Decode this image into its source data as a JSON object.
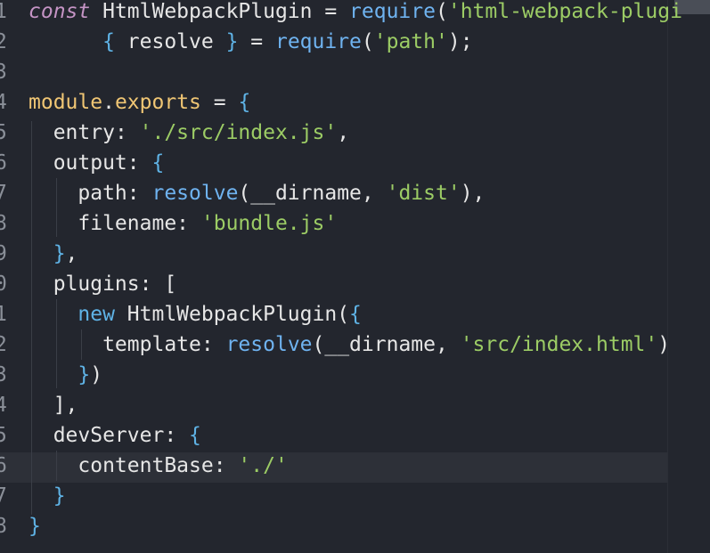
{
  "editor": {
    "language": "javascript",
    "lines": [
      {
        "number": "1",
        "tokens": [
          {
            "t": "const ",
            "c": "kw"
          },
          {
            "t": "HtmlWebpackPlugin ",
            "c": "ident"
          },
          {
            "t": "= ",
            "c": "punc"
          },
          {
            "t": "require",
            "c": "fn"
          },
          {
            "t": "(",
            "c": "punc"
          },
          {
            "t": "'html-webpack-plugi",
            "c": "str"
          }
        ]
      },
      {
        "number": "2",
        "tokens": [
          {
            "t": "      { ",
            "c": "brace"
          },
          {
            "t": "resolve ",
            "c": "ident"
          },
          {
            "t": "} ",
            "c": "brace"
          },
          {
            "t": "= ",
            "c": "punc"
          },
          {
            "t": "require",
            "c": "fn"
          },
          {
            "t": "(",
            "c": "punc"
          },
          {
            "t": "'path'",
            "c": "str"
          },
          {
            "t": ");",
            "c": "punc"
          }
        ]
      },
      {
        "number": "3",
        "tokens": []
      },
      {
        "number": "4",
        "tokens": [
          {
            "t": "module",
            "c": "obj"
          },
          {
            "t": ".",
            "c": "dot"
          },
          {
            "t": "exports ",
            "c": "exports"
          },
          {
            "t": "= ",
            "c": "punc"
          },
          {
            "t": "{",
            "c": "brace"
          }
        ]
      },
      {
        "number": "5",
        "tokens": [
          {
            "t": "  entry",
            "c": "prop"
          },
          {
            "t": ": ",
            "c": "punc"
          },
          {
            "t": "'./src/index.js'",
            "c": "str"
          },
          {
            "t": ",",
            "c": "punc"
          }
        ]
      },
      {
        "number": "6",
        "tokens": [
          {
            "t": "  output",
            "c": "prop"
          },
          {
            "t": ": ",
            "c": "punc"
          },
          {
            "t": "{",
            "c": "brace"
          }
        ]
      },
      {
        "number": "7",
        "tokens": [
          {
            "t": "    path",
            "c": "prop"
          },
          {
            "t": ": ",
            "c": "punc"
          },
          {
            "t": "resolve",
            "c": "fn"
          },
          {
            "t": "(__dirname, ",
            "c": "punc"
          },
          {
            "t": "'dist'",
            "c": "str"
          },
          {
            "t": "),",
            "c": "punc"
          }
        ]
      },
      {
        "number": "8",
        "tokens": [
          {
            "t": "    filename",
            "c": "prop"
          },
          {
            "t": ": ",
            "c": "punc"
          },
          {
            "t": "'bundle.js'",
            "c": "str"
          }
        ]
      },
      {
        "number": "9",
        "tokens": [
          {
            "t": "  }",
            "c": "brace"
          },
          {
            "t": ",",
            "c": "punc"
          }
        ]
      },
      {
        "number": "0",
        "tokens": [
          {
            "t": "  plugins",
            "c": "prop"
          },
          {
            "t": ": [",
            "c": "punc"
          }
        ]
      },
      {
        "number": "1",
        "tokens": [
          {
            "t": "    new ",
            "c": "kw2"
          },
          {
            "t": "HtmlWebpackPlugin",
            "c": "ident"
          },
          {
            "t": "(",
            "c": "punc"
          },
          {
            "t": "{",
            "c": "brace"
          }
        ]
      },
      {
        "number": "2",
        "tokens": [
          {
            "t": "      template",
            "c": "prop"
          },
          {
            "t": ": ",
            "c": "punc"
          },
          {
            "t": "resolve",
            "c": "fn"
          },
          {
            "t": "(__dirname, ",
            "c": "punc"
          },
          {
            "t": "'src/index.html'",
            "c": "str"
          },
          {
            "t": ")",
            "c": "punc"
          }
        ]
      },
      {
        "number": "3",
        "tokens": [
          {
            "t": "    }",
            "c": "brace"
          },
          {
            "t": ")",
            "c": "punc"
          }
        ]
      },
      {
        "number": "4",
        "tokens": [
          {
            "t": "  ],",
            "c": "punc"
          }
        ]
      },
      {
        "number": "5",
        "tokens": [
          {
            "t": "  devServer",
            "c": "prop"
          },
          {
            "t": ": ",
            "c": "punc"
          },
          {
            "t": "{",
            "c": "brace"
          }
        ]
      },
      {
        "number": "6",
        "tokens": [
          {
            "t": "    contentBase",
            "c": "prop"
          },
          {
            "t": ": ",
            "c": "punc"
          },
          {
            "t": "'./'",
            "c": "str"
          }
        ]
      },
      {
        "number": "7",
        "tokens": [
          {
            "t": "  }",
            "c": "brace"
          }
        ]
      },
      {
        "number": "8",
        "tokens": [
          {
            "t": "}",
            "c": "brace"
          }
        ]
      }
    ],
    "current_line_index": 15
  },
  "colors": {
    "background": "#23262e",
    "keyword": "#c594c5",
    "function": "#6fb3f0",
    "string": "#9ccc65",
    "object": "#f0c674"
  }
}
